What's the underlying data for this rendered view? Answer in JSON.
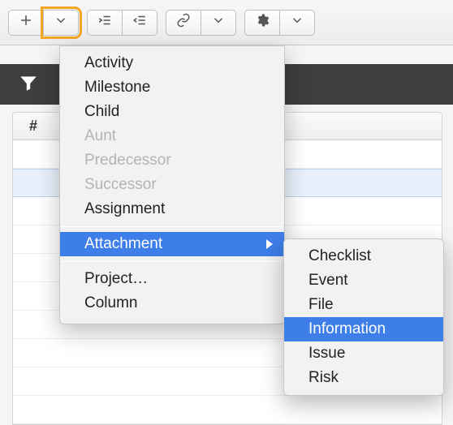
{
  "toolbar": {
    "add_icon": "plus-icon",
    "add_dropdown_icon": "chevron-down-icon",
    "indent_icon": "indent-icon",
    "outdent_icon": "outdent-icon",
    "link_icon": "link-icon",
    "link_dropdown_icon": "chevron-down-icon",
    "gear_icon": "gear-icon",
    "gear_dropdown_icon": "chevron-down-icon"
  },
  "sidebar": {
    "filter_icon": "filter-icon"
  },
  "table": {
    "header": "#"
  },
  "menu": {
    "items": {
      "activity": "Activity",
      "milestone": "Milestone",
      "child": "Child",
      "aunt": "Aunt",
      "predecessor": "Predecessor",
      "successor": "Successor",
      "assignment": "Assignment",
      "attachment": "Attachment",
      "project": "Project…",
      "column": "Column"
    }
  },
  "submenu": {
    "items": {
      "checklist": "Checklist",
      "event": "Event",
      "file": "File",
      "information": "Information",
      "issue": "Issue",
      "risk": "Risk"
    }
  }
}
